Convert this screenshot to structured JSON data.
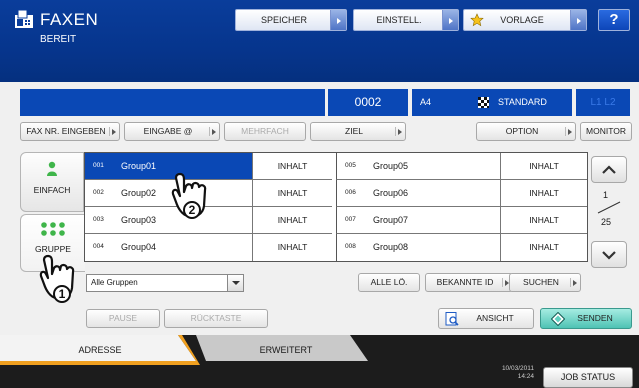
{
  "header": {
    "title": "FAXEN",
    "status": "BEREIT",
    "buttons": {
      "speicher": "SPEICHER",
      "einstell": "EINSTELL.",
      "vorlage": "VORLAGE",
      "help": "?"
    }
  },
  "infobar": {
    "count": "0002",
    "paper": "A4",
    "quality": "STANDARD",
    "channel": "L1 L2"
  },
  "input_buttons": {
    "fax_nr": "FAX NR. EINGEBEN",
    "eingabe": "EINGABE @",
    "mehrfach": "MEHRFACH",
    "ziel": "ZIEL",
    "option": "OPTION",
    "monitor": "MONITOR"
  },
  "side_tabs": {
    "einfach": "EINFACH",
    "gruppe": "GRUPPE"
  },
  "groups_left": [
    {
      "num": "001",
      "name": "Group01",
      "action": "INHALT"
    },
    {
      "num": "002",
      "name": "Group02",
      "action": "INHALT"
    },
    {
      "num": "003",
      "name": "Group03",
      "action": "INHALT"
    },
    {
      "num": "004",
      "name": "Group04",
      "action": "INHALT"
    }
  ],
  "groups_right": [
    {
      "num": "005",
      "name": "Group05",
      "action": "INHALT"
    },
    {
      "num": "006",
      "name": "Group06",
      "action": "INHALT"
    },
    {
      "num": "007",
      "name": "Group07",
      "action": "INHALT"
    },
    {
      "num": "008",
      "name": "Group08",
      "action": "INHALT"
    }
  ],
  "pager": {
    "current": "1",
    "total": "25"
  },
  "group_select": {
    "value": "Alle Gruppen"
  },
  "list_buttons": {
    "alle_lo": "ALLE LÖ.",
    "bekannte_id": "BEKANNTE ID",
    "suchen": "SUCHEN"
  },
  "action_buttons": {
    "pause": "PAUSE",
    "ruecktaste": "RÜCKTASTE",
    "ansicht": "ANSICHT",
    "senden": "SENDEN"
  },
  "bottom_tabs": {
    "adresse": "ADRESSE",
    "erweitert": "ERWEITERT"
  },
  "footer": {
    "date": "10/03/2011",
    "time": "14:24",
    "job_status": "JOB STATUS"
  },
  "colors": {
    "header_blue": "#0a3d9b",
    "selection_blue": "#0a48b5",
    "active_tab": "#f0a020",
    "senden_green": "#5fcfbf"
  },
  "annotations": {
    "step1": "1",
    "step2": "2"
  }
}
